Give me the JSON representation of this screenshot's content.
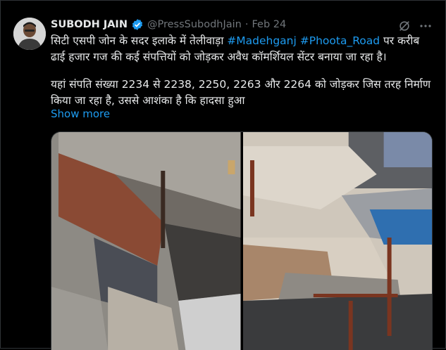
{
  "tweet": {
    "author_name": "SUBODH JAIN",
    "handle": "@PressSubodhJain",
    "separator": "·",
    "date": "Feb 24",
    "line1_prefix": "सिटी एसपी जोन के सदर इलाके में तेलीवाड़ा ",
    "hashtag1": "#Madehganj",
    "space": " ",
    "hashtag2": "#Phoota_Road",
    "line1_suffix": " पर करीब ढाई हजार गज की कई संपत्तियों को जोड़कर अवैध कॉमर्शियल सेंटर बनाया जा रहा है।",
    "paragraph2": "यहां संपति संख्या 2234 से 2238, 2250, 2263 और 2264 को जोड़कर जिस तरह निर्माण किया जा रहा है, उससे आशंका है कि हादसा हुआ",
    "show_more": "Show more"
  },
  "icons": {
    "verified": "verified-badge-icon",
    "grok": "grok-icon",
    "more": "more-options-icon"
  },
  "colors": {
    "background": "#000000",
    "text": "#e7e9ea",
    "muted": "#71767b",
    "link": "#1d9bf0",
    "border": "#2f3336"
  }
}
